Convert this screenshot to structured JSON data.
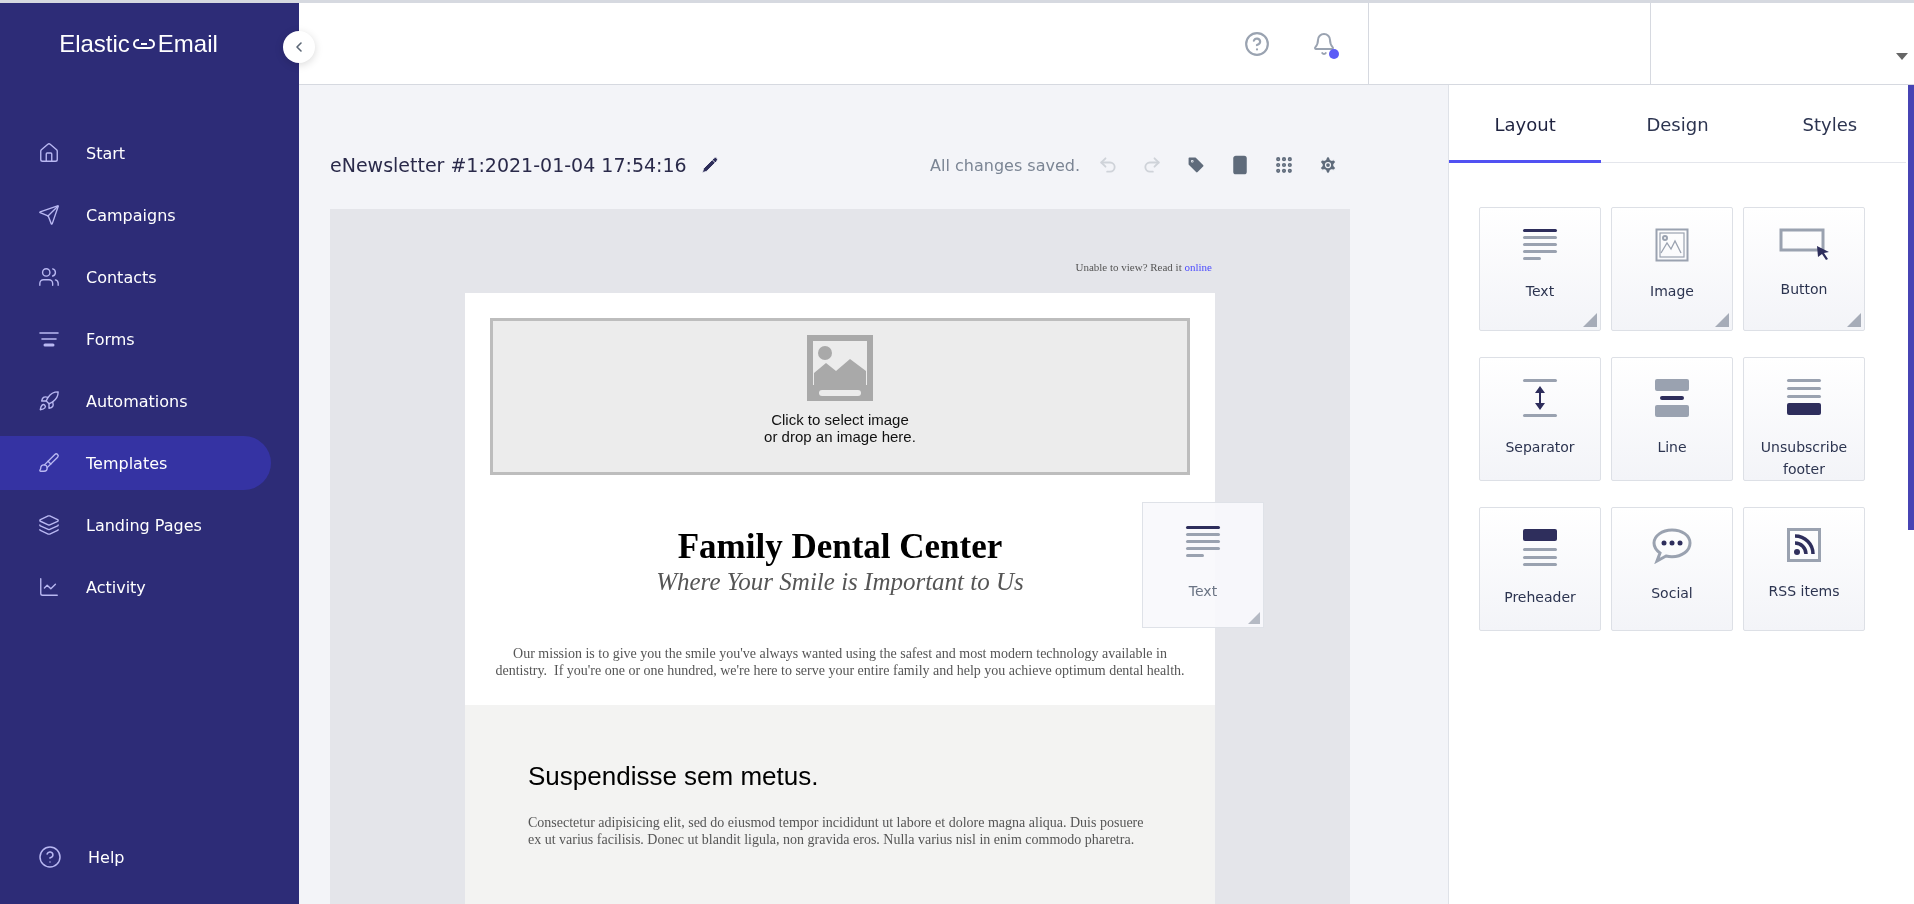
{
  "sidebar": {
    "brand": {
      "first": "Elastic",
      "second": "Email"
    },
    "items": [
      {
        "label": "Start",
        "selected": false
      },
      {
        "label": "Campaigns",
        "selected": false
      },
      {
        "label": "Contacts",
        "selected": false
      },
      {
        "label": "Forms",
        "selected": false
      },
      {
        "label": "Automations",
        "selected": false
      },
      {
        "label": "Templates",
        "selected": true
      },
      {
        "label": "Landing Pages",
        "selected": false
      },
      {
        "label": "Activity",
        "selected": false
      }
    ],
    "help": {
      "label": "Help"
    }
  },
  "header": {
    "notifications": {
      "unread": true
    }
  },
  "editor": {
    "title": "eNewsletter #1:2021-01-04 17:54:16",
    "status": "All changes saved.",
    "tools": [
      {
        "disabled": true
      },
      {
        "disabled": true
      },
      {
        "disabled": false
      },
      {
        "disabled": false
      },
      {
        "disabled": false
      },
      {
        "disabled": false
      }
    ]
  },
  "email": {
    "view_online": {
      "text": "Unable to view? Read it",
      "link": "online"
    },
    "image_placeholder": {
      "lines": [
        "Click to select image",
        "or drop an image here."
      ]
    },
    "heading": "Family Dental Center",
    "tagline": "Where Your Smile is Important to Us",
    "mission": "Our mission is to give you the smile you've always wanted using the safest and most modern technology available in dentistry.  If you're one or one hundred, we're here to serve your entire family and help you achieve optimum dental health.",
    "section": {
      "heading": "Suspendisse sem metus.",
      "body": "Consectetur adipisicing elit, sed do eiusmod tempor incididunt ut labore et dolore magna aliqua. Duis posuere ex ut varius facilisis. Donec ut blandit ligula, non gravida eros. Nulla varius nisl in enim commodo pharetra."
    }
  },
  "drag_card": {
    "label": "Text"
  },
  "panel": {
    "tabs": [
      {
        "label": "Layout",
        "selected": true
      },
      {
        "label": "Design",
        "selected": false
      },
      {
        "label": "Styles",
        "selected": false
      }
    ],
    "blocks": [
      {
        "label": "Text",
        "expandable": true
      },
      {
        "label": "Image",
        "expandable": true
      },
      {
        "label": "Button",
        "expandable": true
      },
      {
        "label": "Separator",
        "expandable": false
      },
      {
        "label": "Line",
        "expandable": false
      },
      {
        "label": "Unsubscribe footer",
        "expandable": false
      },
      {
        "label": "Preheader",
        "expandable": false
      },
      {
        "label": "Social",
        "expandable": false
      },
      {
        "label": "RSS items",
        "expandable": false
      }
    ]
  }
}
